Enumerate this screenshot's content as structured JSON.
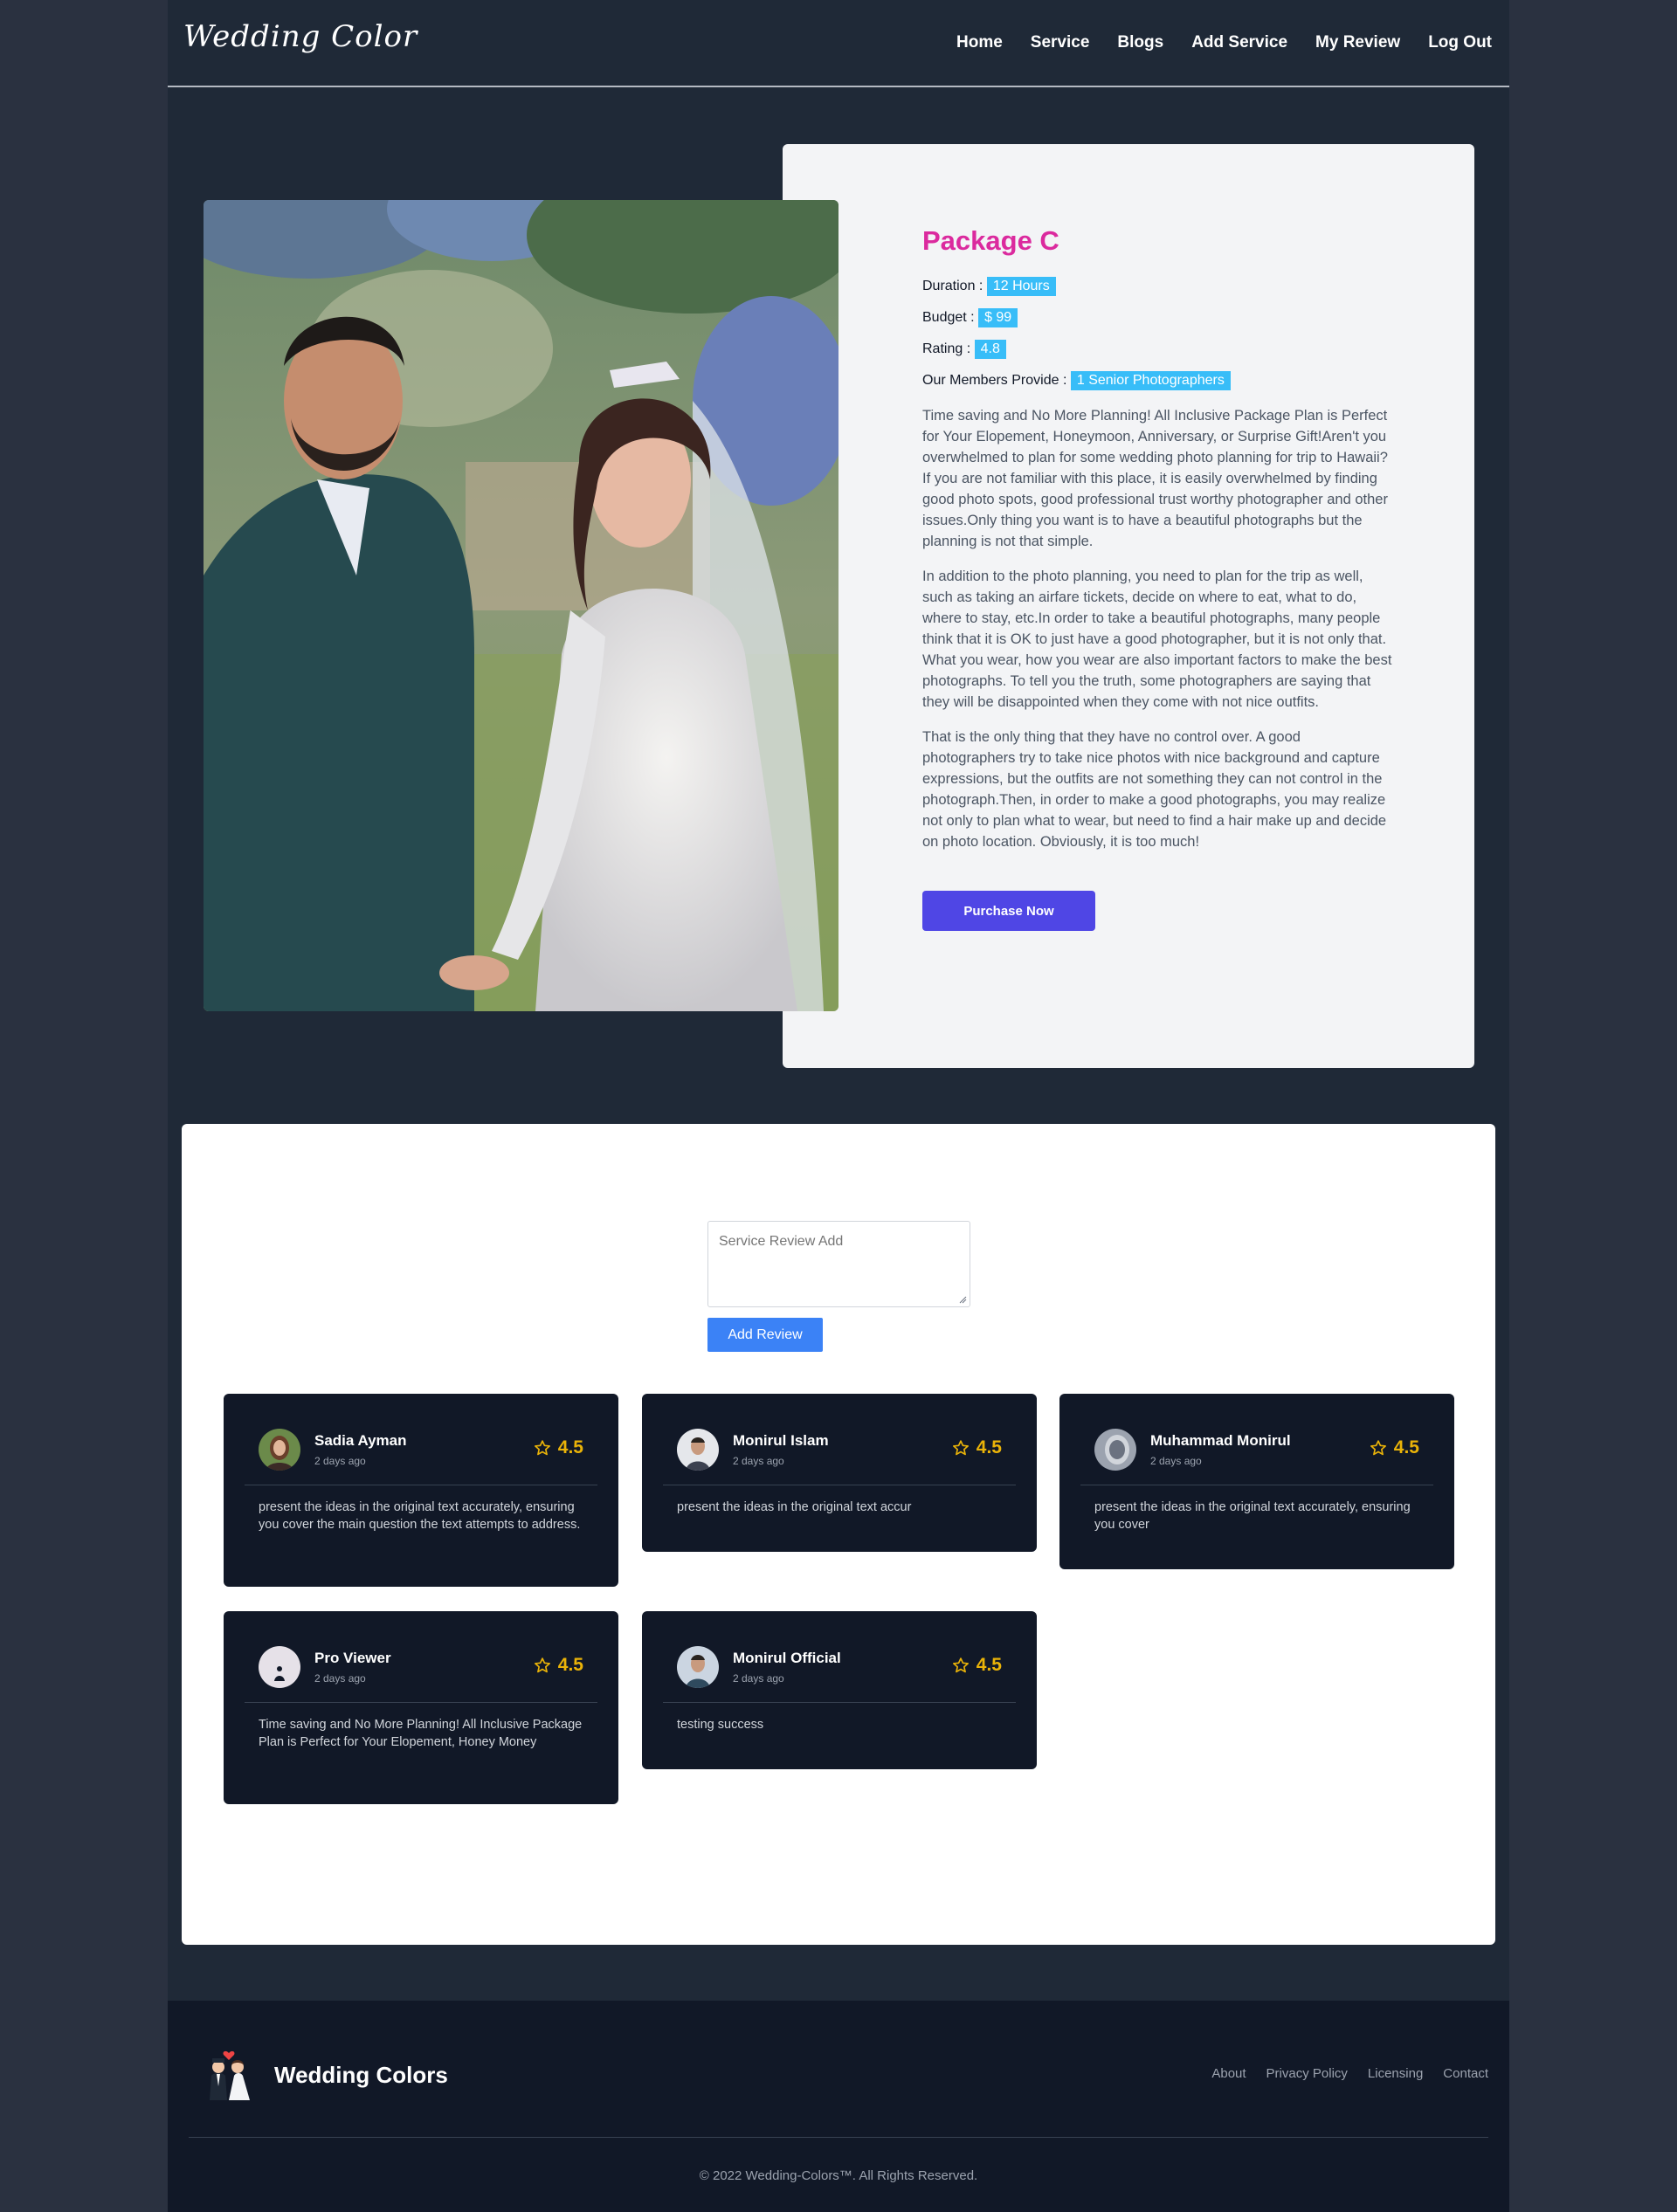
{
  "header": {
    "logo": "Wedding Color",
    "nav": [
      "Home",
      "Service",
      "Blogs",
      "Add Service",
      "My Review",
      "Log Out"
    ]
  },
  "package": {
    "title": "Package C",
    "duration_label": "Duration :",
    "duration": "12 Hours",
    "budget_label": "Budget :",
    "budget": "$ 99",
    "rating_label": "Rating :",
    "rating": "4.8",
    "members_label": "Our Members Provide :",
    "members": "1 Senior Photographers",
    "paragraphs": [
      "Time saving and No More Planning! All Inclusive Package Plan is Perfect for Your Elopement, Honeymoon, Anniversary, or Surprise Gift!Aren't you overwhelmed to plan for some wedding photo planning for trip to Hawaii? If you are not familiar with this place, it is easily overwhelmed by finding good photo spots, good professional trust worthy photographer and other issues.Only thing you want is to have a beautiful photographs but the planning is not that simple.",
      "In addition to the photo planning, you need to plan for the trip as well, such as taking an airfare tickets, decide on where to eat, what to do, where to stay, etc.In order to take a beautiful photographs, many people think that it is OK to just have a good photographer, but it is not only that. What you wear, how you wear are also important factors to make the best photographs. To tell you the truth, some photographers are saying that they will be disappointed when they come with not nice outfits.",
      "That is the only thing that they have no control over. A good photographers try to take nice photos with nice background and capture expressions, but the outfits are not something they can not control in the photograph.Then, in order to make a good photographs, you may realize not only to plan what to wear, but need to find a hair make up and decide on photo location. Obviously, it is too much!"
    ],
    "purchase_label": "Purchase Now"
  },
  "review_form": {
    "placeholder": "Service Review Add",
    "submit_label": "Add Review"
  },
  "reviews": [
    {
      "name": "Sadia Ayman",
      "time": "2 days ago",
      "rating": "4.5",
      "text": "present the ideas in the original text accurately, ensuring you cover the main question the text attempts to address."
    },
    {
      "name": "Monirul Islam",
      "time": "2 days ago",
      "rating": "4.5",
      "text": "present the ideas in the original text accur"
    },
    {
      "name": "Muhammad Monirul",
      "time": "2 days ago",
      "rating": "4.5",
      "text": "present the ideas in the original text accurately, ensuring you cover"
    },
    {
      "name": "Pro Viewer",
      "time": "2 days ago",
      "rating": "4.5",
      "text": "Time saving and No More Planning! All Inclusive Package Plan is Perfect for Your Elopement, Honey Money"
    },
    {
      "name": "Monirul Official",
      "time": "2 days ago",
      "rating": "4.5",
      "text": "testing success"
    }
  ],
  "footer": {
    "brand": "Wedding Colors",
    "links": [
      "About",
      "Privacy Policy",
      "Licensing",
      "Contact"
    ],
    "copyright": "© 2022 Wedding-Colors™. All Rights Reserved."
  },
  "colors": {
    "page_bg": "#1f2937",
    "title_pink": "#db2a9e",
    "chip_blue": "#38bdf8",
    "purchase_indigo": "#4f46e5",
    "add_review_blue": "#3b82f6",
    "card_bg": "#111827",
    "star_yellow": "#eab308"
  }
}
